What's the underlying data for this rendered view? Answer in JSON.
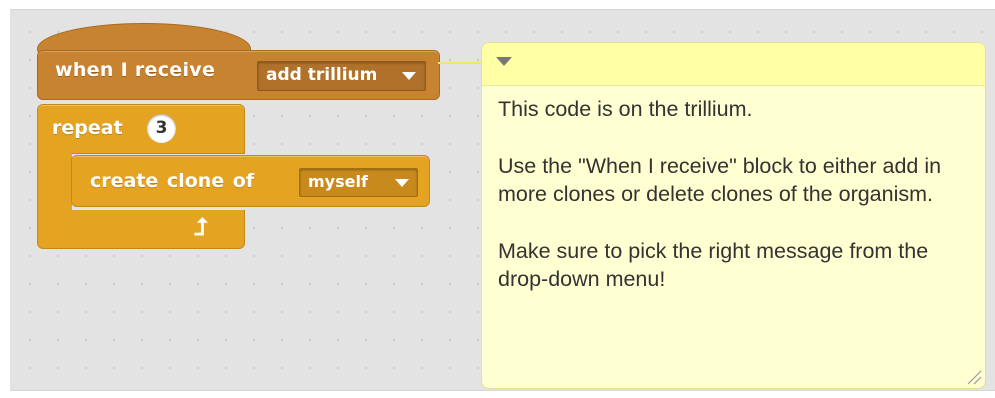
{
  "hat_block": {
    "label": "when I receive",
    "message": "add trillium",
    "color": "#c88330"
  },
  "repeat_block": {
    "label": "repeat",
    "count": "3",
    "loop_arrow": "⮥",
    "color": "#e5a322"
  },
  "clone_block": {
    "label": "create clone of",
    "target": "myself",
    "color": "#e5a322"
  },
  "comment": {
    "line1": "This code is on the trillium.",
    "line2": "Use the \"When I receive\" block to either add in more clones or delete clones of the organism.",
    "line3": "Make sure to pick the right message from the drop-down menu!",
    "background": "#ffffd2",
    "bar_color": "#ffffa5"
  },
  "icons": {
    "comment_toggle": "triangle-down-icon",
    "resize": "resize-grip-icon",
    "dropdown": "caret-down-icon",
    "loop": "loop-arrow-icon"
  }
}
